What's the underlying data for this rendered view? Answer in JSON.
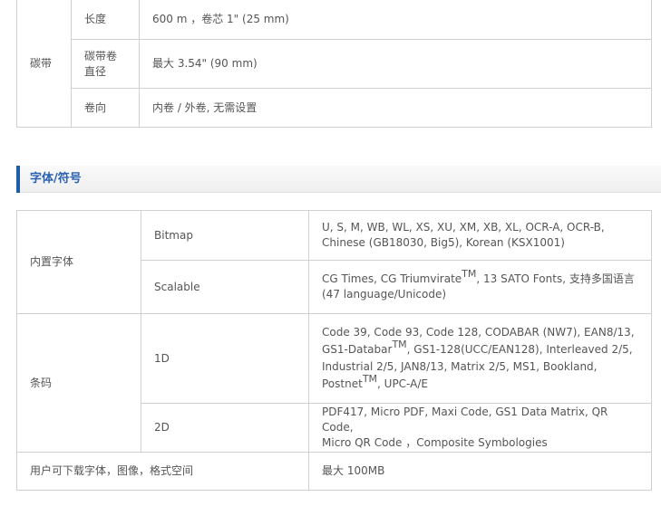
{
  "ribbon": {
    "group": "碳带",
    "rows": [
      {
        "label": "长度",
        "value": "600 m ，卷芯 1\" (25 mm)"
      },
      {
        "label": "碳带卷直径",
        "value": "最大 3.54\" (90 mm)"
      },
      {
        "label": "卷向",
        "value": "内卷 / 外卷, 无需设置"
      }
    ]
  },
  "section": {
    "title": "字体/符号"
  },
  "fonts": {
    "group": "内置字体",
    "bitmap_label": "Bitmap",
    "bitmap_value_1": "U, S, M, WB, WL, XS, XU, XM, XB, XL, OCR-A, OCR-B,",
    "bitmap_value_2": "Chinese (GB18030, Big5), Korean (KSX1001)",
    "scalable_label": "Scalable",
    "scalable_a": "CG Times, CG Triumvirate",
    "scalable_b": ", 13 SATO Fonts,  支持多国语言",
    "scalable_c": "(47 language/Unicode)",
    "tm": "TM"
  },
  "barcode": {
    "group": "条码",
    "d1_label": "1D",
    "d1_a": "Code 39, Code 93, Code 128, CODABAR (NW7), EAN8/13,",
    "d1_b": "GS1-Databar",
    "d1_c": ", GS1-128(UCC/EAN128), Interleaved 2/5,",
    "d1_d": "Industrial 2/5, JAN8/13, Matrix 2/5, MS1, Bookland,",
    "d1_e": "Postnet",
    "d1_f": ", UPC-A/E",
    "d2_label": "2D",
    "d2_a": "PDF417, Micro PDF, Maxi Code, GS1 Data Matrix, QR Code,",
    "d2_b": "Micro QR Code ，Composite Symbologies"
  },
  "download": {
    "label": "用户可下载字体，图像，格式空间",
    "value": "最大 100MB"
  }
}
